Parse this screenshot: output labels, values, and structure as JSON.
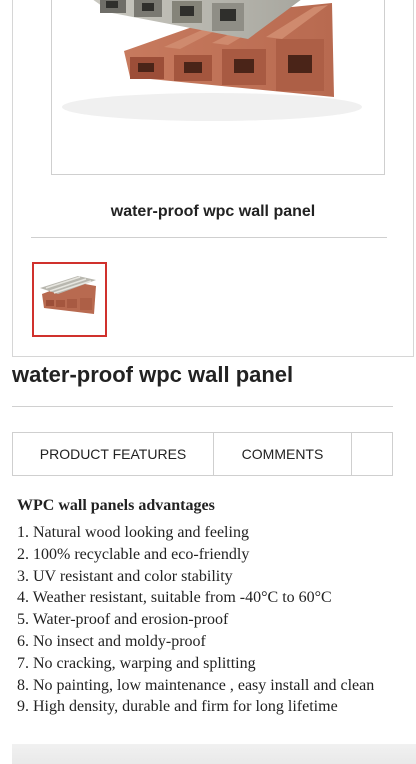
{
  "gallery": {
    "caption": "water-proof wpc wall panel",
    "thumbnail_icon": "product-thumbnail-image"
  },
  "product": {
    "title": "water-proof wpc wall panel"
  },
  "tabs": [
    {
      "label": "PRODUCT FEATURES"
    },
    {
      "label": "COMMENTS"
    },
    {
      "label": ""
    }
  ],
  "content": {
    "heading": "WPC wall panels advantages",
    "items": [
      "1. Natural wood looking and feeling",
      "2. 100% recyclable and eco-friendly",
      "3. UV resistant and color stability",
      "4. Weather resistant, suitable from -40°C to 60°C",
      "5. Water-proof and erosion-proof",
      "6. No insect and moldy-proof",
      "7. No cracking, warping and splitting",
      "8. No painting, low maintenance , easy install and clean",
      "9. High density, durable and firm for long lifetime"
    ]
  },
  "colors": {
    "thumbnail_border": "#d0312d",
    "panel_brown": "#b5634a",
    "panel_grey": "#9a9a92"
  }
}
